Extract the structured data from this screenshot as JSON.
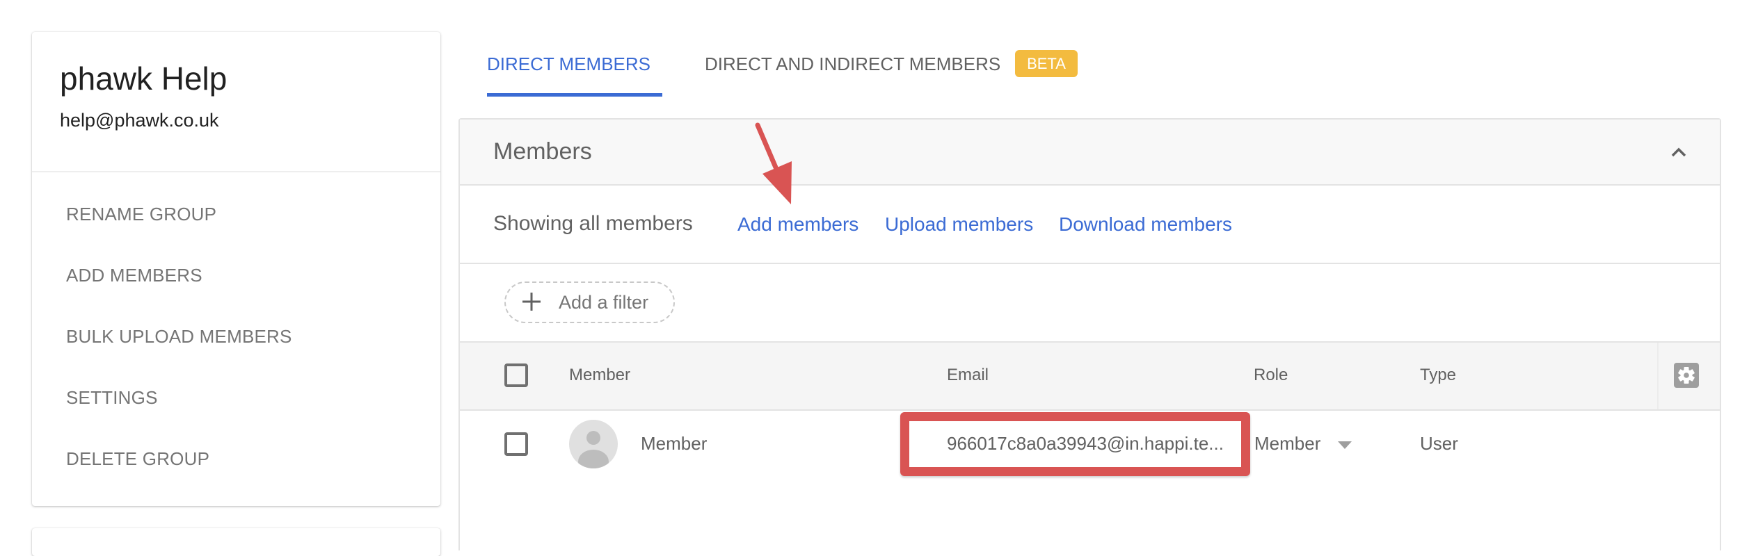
{
  "group": {
    "name": "phawk Help",
    "email": "help@phawk.co.uk"
  },
  "sidebar": {
    "items": [
      {
        "label": "RENAME GROUP"
      },
      {
        "label": "ADD MEMBERS"
      },
      {
        "label": "BULK UPLOAD MEMBERS"
      },
      {
        "label": "SETTINGS"
      },
      {
        "label": "DELETE GROUP"
      }
    ]
  },
  "tabs": [
    {
      "label": "DIRECT MEMBERS",
      "active": true
    },
    {
      "label": "DIRECT AND INDIRECT MEMBERS",
      "active": false,
      "badge": "BETA"
    }
  ],
  "panel": {
    "title": "Members",
    "collapse_icon": "chevron-up-icon",
    "showing_text": "Showing all members",
    "actions": [
      {
        "label": "Add members"
      },
      {
        "label": "Upload members"
      },
      {
        "label": "Download members"
      }
    ],
    "filter": {
      "icon": "plus-icon",
      "label": "Add a filter"
    }
  },
  "table": {
    "columns": [
      "Member",
      "Email",
      "Role",
      "Type"
    ],
    "settings_icon": "gear-icon",
    "rows": [
      {
        "name": "Member",
        "email": "966017c8a0a39943@in.happi.te...",
        "role": "Member",
        "type": "User",
        "avatar_icon": "person-icon"
      }
    ]
  },
  "annotations": {
    "arrow_color": "#d95453",
    "highlight_color": "#d95453",
    "arrow_target": "Add members",
    "highlight_target": "email"
  },
  "colors": {
    "accent": "#3b6bd4",
    "badge": "#f3bb3f",
    "text_secondary": "#616161"
  }
}
